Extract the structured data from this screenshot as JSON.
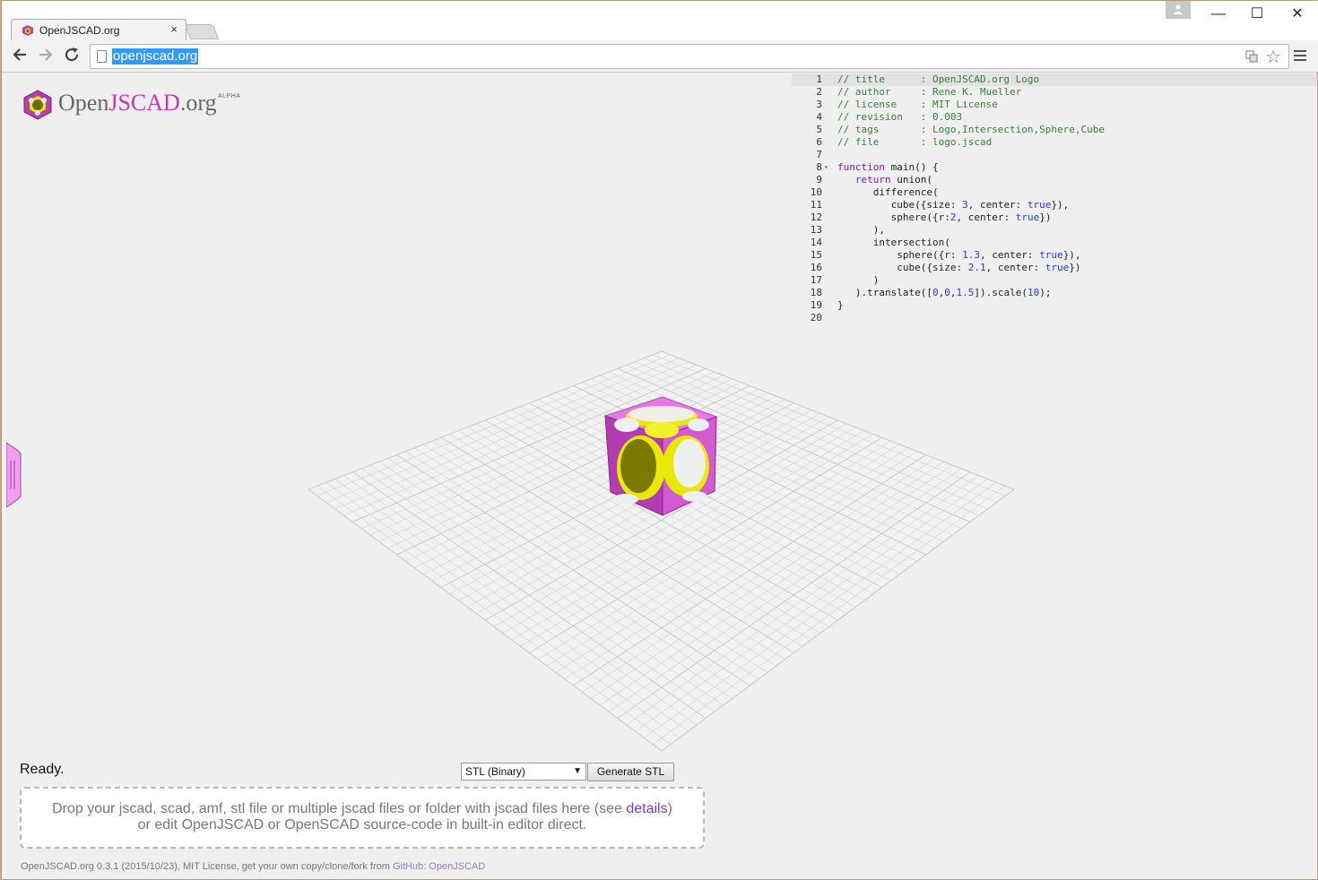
{
  "browser": {
    "tab_title": "OpenJSCAD.org",
    "tab_close": "×",
    "url": "openjscad.org",
    "window_controls": {
      "minimize": "—",
      "maximize": "☐",
      "close": "✕"
    }
  },
  "logo": {
    "open": "Open",
    "jscad": "JSCAD",
    "org": ".org",
    "alpha": "ALPHA"
  },
  "editor": {
    "active_line": 1,
    "lines": [
      {
        "n": "1",
        "fold": "",
        "html": "<span class='c-comment'>// title      : OpenJSCAD.org Logo</span>"
      },
      {
        "n": "2",
        "fold": "",
        "html": "<span class='c-comment'>// author     : Rene K. Mueller</span>"
      },
      {
        "n": "3",
        "fold": "",
        "html": "<span class='c-comment'>// license    : MIT License</span>"
      },
      {
        "n": "4",
        "fold": "",
        "html": "<span class='c-comment'>// revision   : 0.003</span>"
      },
      {
        "n": "5",
        "fold": "",
        "html": "<span class='c-comment'>// tags       : Logo,Intersection,Sphere,Cube</span>"
      },
      {
        "n": "6",
        "fold": "",
        "html": "<span class='c-comment'>// file       : logo.jscad</span>"
      },
      {
        "n": "7",
        "fold": "",
        "html": ""
      },
      {
        "n": "8",
        "fold": "▾",
        "html": "<span class='c-kw'>function</span> main() {"
      },
      {
        "n": "9",
        "fold": "",
        "html": "   <span class='c-kw'>return</span> union("
      },
      {
        "n": "10",
        "fold": "",
        "html": "      difference("
      },
      {
        "n": "11",
        "fold": "",
        "html": "         cube({size: <span class='c-num'>3</span>, center: <span class='c-bool'>true</span>}),"
      },
      {
        "n": "12",
        "fold": "",
        "html": "         sphere({r:<span class='c-num'>2</span>, center: <span class='c-bool'>true</span>})"
      },
      {
        "n": "13",
        "fold": "",
        "html": "      ),"
      },
      {
        "n": "14",
        "fold": "",
        "html": "      intersection("
      },
      {
        "n": "15",
        "fold": "",
        "html": "          sphere({r: <span class='c-num'>1.3</span>, center: <span class='c-bool'>true</span>}),"
      },
      {
        "n": "16",
        "fold": "",
        "html": "          cube({size: <span class='c-num'>2.1</span>, center: <span class='c-bool'>true</span>})"
      },
      {
        "n": "17",
        "fold": "",
        "html": "      )"
      },
      {
        "n": "18",
        "fold": "",
        "html": "   ).translate([<span class='c-num'>0</span>,<span class='c-num'>0</span>,<span class='c-num'>1.5</span>]).scale(<span class='c-num'>10</span>);"
      },
      {
        "n": "19",
        "fold": "",
        "html": "}"
      },
      {
        "n": "20",
        "fold": "",
        "html": ""
      }
    ]
  },
  "status": {
    "text": "Ready."
  },
  "export": {
    "format_selected": "STL (Binary)",
    "generate_label": "Generate STL"
  },
  "dropzone": {
    "line1_before": "Drop your jscad, scad, amf, stl file or multiple jscad files or folder with jscad files here (see ",
    "line1_link": "details",
    "line1_after": ")",
    "line2": "or edit OpenJSCAD or OpenSCAD source-code in built-in editor direct."
  },
  "footer": {
    "text": "OpenJSCAD.org 0.3.1 (2015/10/23), MIT License, get your own copy/clone/fork from ",
    "link": "GitHub: OpenJSCAD"
  },
  "colors": {
    "brand_magenta": "#c13ab7",
    "cube_magenta": "#e05ee0",
    "sphere_yellow": "#e8e800",
    "selection_blue": "#3399ff"
  }
}
